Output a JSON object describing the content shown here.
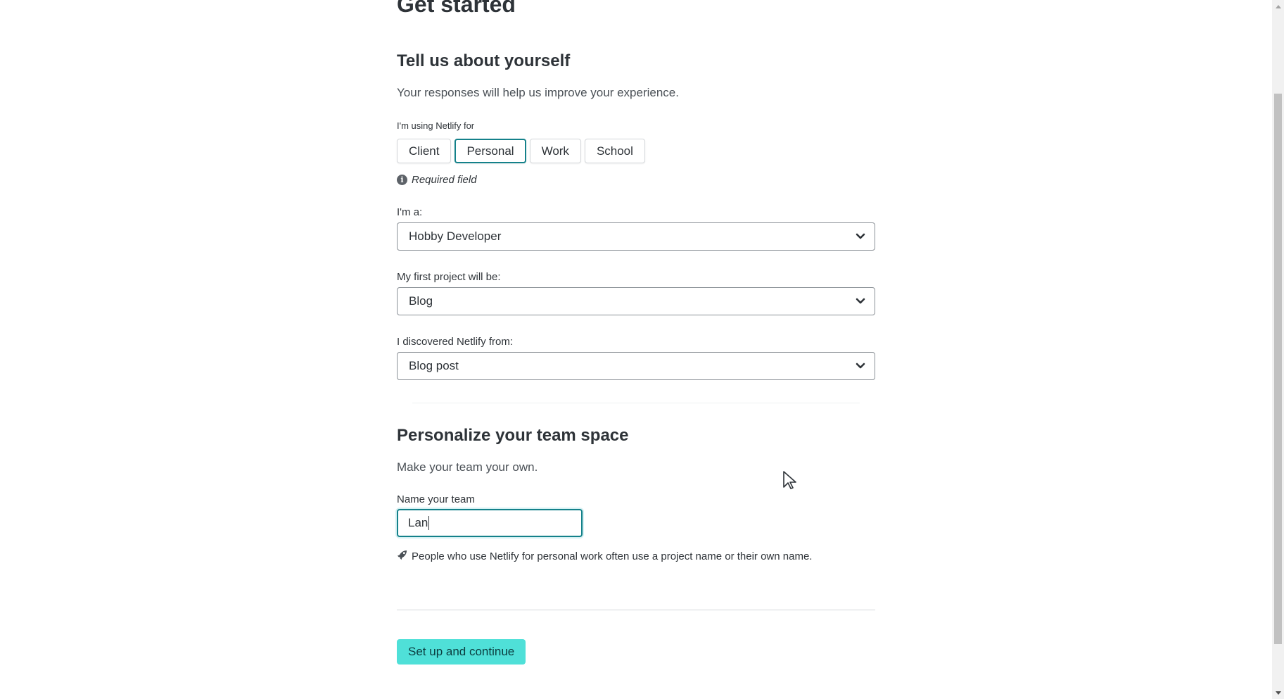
{
  "page": {
    "title": "Get started"
  },
  "about": {
    "title": "Tell us about yourself",
    "description": "Your responses will help us improve your experience.",
    "usage_label": "I'm using Netlify for",
    "usage_options": [
      "Client",
      "Personal",
      "Work",
      "School"
    ],
    "usage_selected": "Personal",
    "required_text": "Required field",
    "role_label": "I'm a:",
    "role_value": "Hobby Developer",
    "project_label": "My first project will be:",
    "project_value": "Blog",
    "discovery_label": "I discovered Netlify from:",
    "discovery_value": "Blog post"
  },
  "team": {
    "title": "Personalize your team space",
    "description": "Make your team your own.",
    "name_label": "Name your team",
    "name_value": "Lan",
    "hint": "People who use Netlify for personal work often use a project name or their own name."
  },
  "actions": {
    "submit_label": "Set up and continue"
  },
  "colors": {
    "accent": "#14818a",
    "primary_button": "#4fe0d8"
  },
  "icons": {
    "info": "info-icon",
    "hint": "rocket-icon",
    "select": "chevron-down-icon"
  }
}
